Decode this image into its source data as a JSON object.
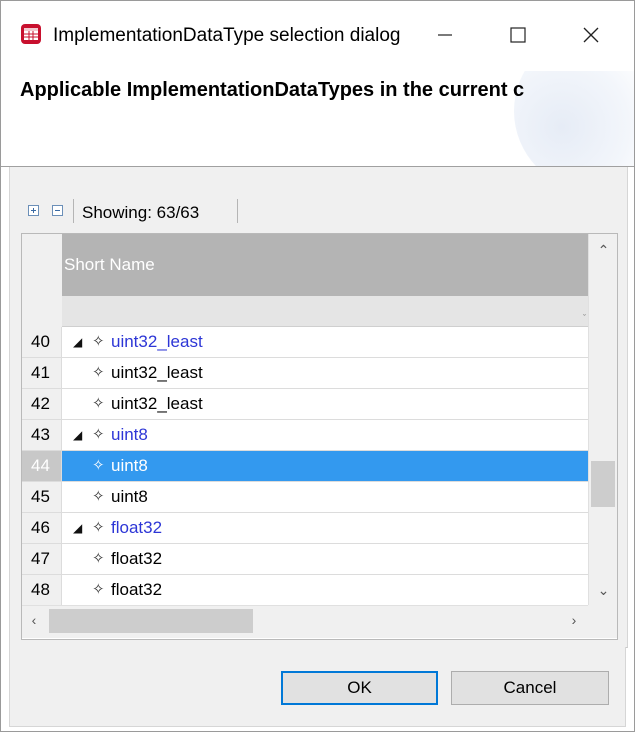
{
  "window": {
    "title": "ImplementationDataType selection dialog",
    "controls": {
      "minimize": "minimize-icon",
      "maximize": "maximize-icon",
      "close": "close-icon"
    }
  },
  "banner": {
    "heading": "Applicable ImplementationDataTypes in the current c"
  },
  "toolbar": {
    "expand_all_icon": "expand-all-icon",
    "collapse_all_icon": "collapse-all-icon",
    "showing": "Showing: 63/63"
  },
  "table": {
    "column_header": "Short Name",
    "rows": [
      {
        "num": "40",
        "label": "uint32_least",
        "parent": true
      },
      {
        "num": "41",
        "label": "uint32_least",
        "parent": false
      },
      {
        "num": "42",
        "label": "uint32_least",
        "parent": false
      },
      {
        "num": "43",
        "label": "uint8",
        "parent": true
      },
      {
        "num": "44",
        "label": "uint8",
        "parent": false,
        "selected": true
      },
      {
        "num": "45",
        "label": "uint8",
        "parent": false
      },
      {
        "num": "46",
        "label": "float32",
        "parent": true
      },
      {
        "num": "47",
        "label": "float32",
        "parent": false
      },
      {
        "num": "48",
        "label": "float32",
        "parent": false
      }
    ]
  },
  "buttons": {
    "ok": "OK",
    "cancel": "Cancel"
  },
  "colors": {
    "selection": "#3399ef",
    "parent_text": "#2d36d6",
    "header_bg": "#b4b4b4",
    "default_button_border": "#0078d7"
  }
}
